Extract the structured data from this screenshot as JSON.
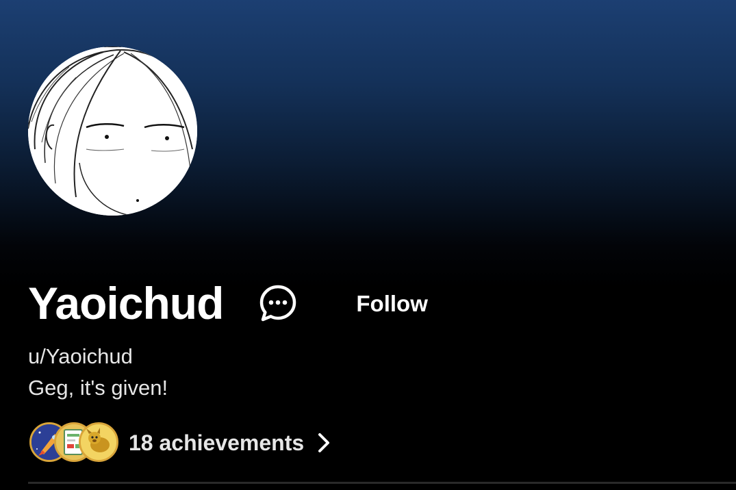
{
  "profile": {
    "display_name": "Yaoichud",
    "username": "u/Yaoichud",
    "bio": "Geg, it's given!",
    "follow_label": "Follow",
    "avatar_icon": "avatar-manga-face"
  },
  "icons": {
    "chat": "chat-bubble-icon",
    "chevron": "chevron-right-icon"
  },
  "achievements": {
    "label": "18 achievements",
    "badges": [
      "rocket-badge-icon",
      "document-badge-icon",
      "dog-badge-icon"
    ]
  },
  "colors": {
    "header_top": "#1c3f72",
    "background": "#000000",
    "text": "#ffffff",
    "badge_border": "#d9a53a"
  }
}
